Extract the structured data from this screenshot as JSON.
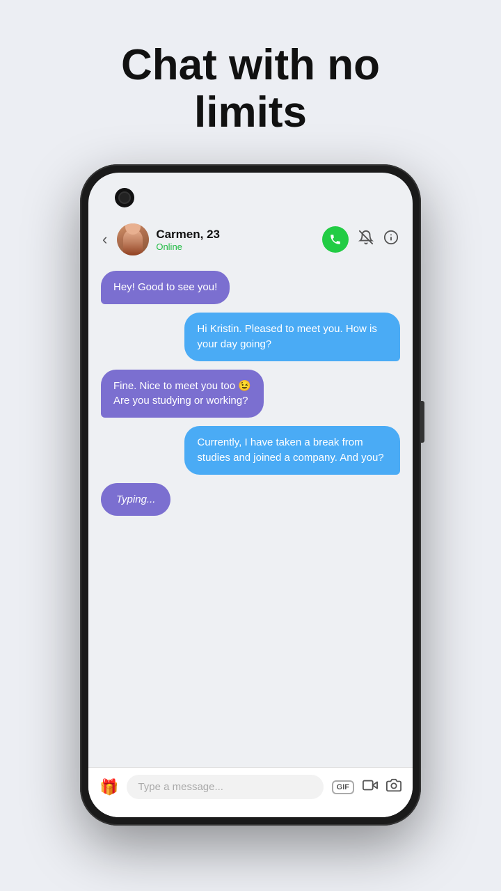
{
  "headline": {
    "line1": "Chat with no",
    "line2": "limits"
  },
  "contact": {
    "name": "Carmen, 23",
    "status": "Online"
  },
  "messages": [
    {
      "id": 1,
      "text": "Hey! Good to see you!",
      "side": "left"
    },
    {
      "id": 2,
      "text": "Hi Kristin. Pleased to meet you. How is your day going?",
      "side": "right"
    },
    {
      "id": 3,
      "text": "Fine. Nice to meet you too 😉\nAre you studying or working?",
      "side": "left"
    },
    {
      "id": 4,
      "text": "Currently, I have taken a break from studies and joined a company. And you?",
      "side": "right"
    },
    {
      "id": 5,
      "text": "Typing...",
      "side": "typing"
    }
  ],
  "header_icons": {
    "back": "‹",
    "phone": "📞",
    "mute": "🔕",
    "info": "ℹ"
  },
  "bottom_bar": {
    "gift_icon": "🎁",
    "placeholder": "Type a message...",
    "gif_label": "GIF",
    "video_icon": "📹",
    "camera_icon": "📷"
  }
}
